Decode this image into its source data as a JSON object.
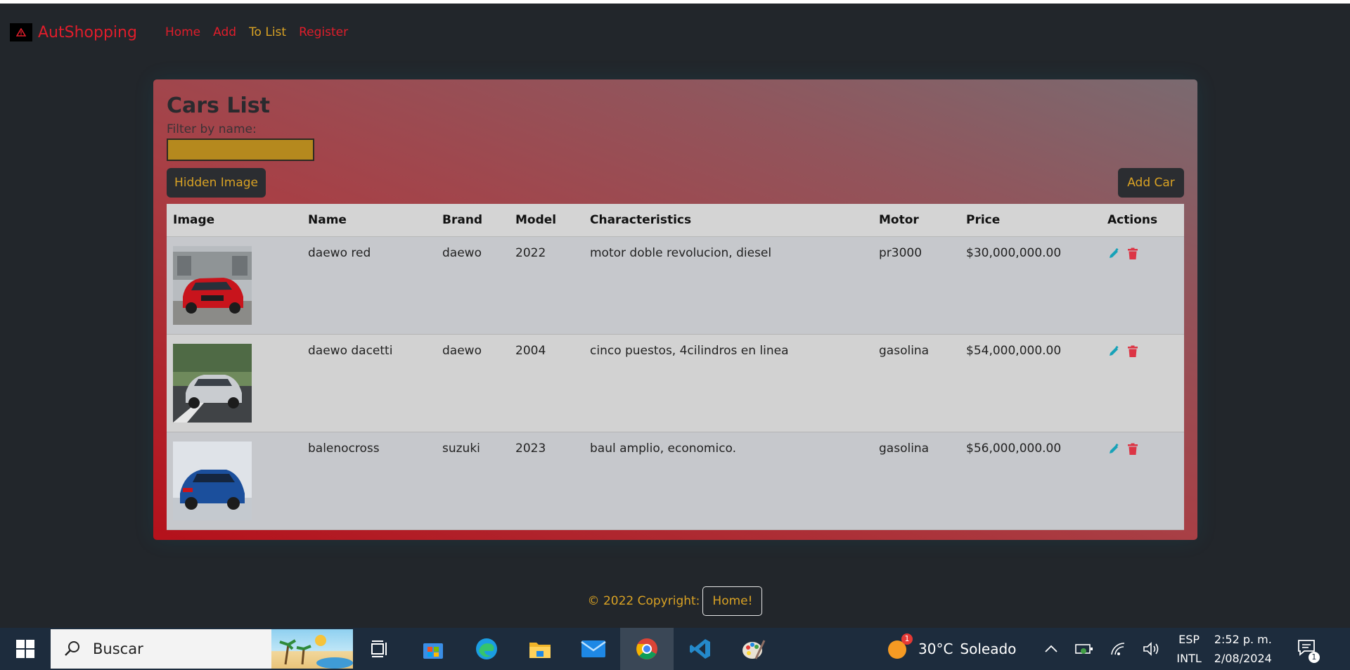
{
  "nav": {
    "brand": "AutShopping",
    "links": [
      "Home",
      "Add",
      "To List",
      "Register"
    ],
    "active": "To List"
  },
  "page": {
    "title": "Cars List",
    "filter_label": "Filter by name:",
    "filter_value": "",
    "hidden_image_button": "Hidden Image",
    "add_car_button": "Add Car"
  },
  "table": {
    "headers": [
      "Image",
      "Name",
      "Brand",
      "Model",
      "Characteristics",
      "Motor",
      "Price",
      "Actions"
    ],
    "rows": [
      {
        "image": "red-car-photo",
        "name": "daewo red",
        "brand": "daewo",
        "model": "2022",
        "characteristics": "motor doble revolucion, diesel",
        "motor": "pr3000",
        "price": "$30,000,000.00"
      },
      {
        "image": "silver-car-photo",
        "name": "daewo dacetti",
        "brand": "daewo",
        "model": "2004",
        "characteristics": "cinco puestos, 4cilindros en linea",
        "motor": "gasolina",
        "price": "$54,000,000.00"
      },
      {
        "image": "blue-car-photo",
        "name": "balenocross",
        "brand": "suzuki",
        "model": "2023",
        "characteristics": "baul amplio, economico.",
        "motor": "gasolina",
        "price": "$56,000,000.00"
      }
    ],
    "action_icons": [
      "pencil-icon",
      "trash-icon"
    ]
  },
  "footer": {
    "text": "© 2022 Copyright:",
    "button": "Home!"
  },
  "taskbar": {
    "search_placeholder": "Buscar",
    "weather_temp": "30°C",
    "weather_desc": "Soleado",
    "weather_badge": "1",
    "lang_line1": "ESP",
    "lang_line2": "INTL",
    "time": "2:52 p. m.",
    "date": "2/08/2024",
    "notification_count": "1"
  },
  "colors": {
    "brand_red": "#e01d2b",
    "accent_gold": "#d9a224",
    "edit_blue": "#17a2b8",
    "delete_red": "#dc3545"
  }
}
